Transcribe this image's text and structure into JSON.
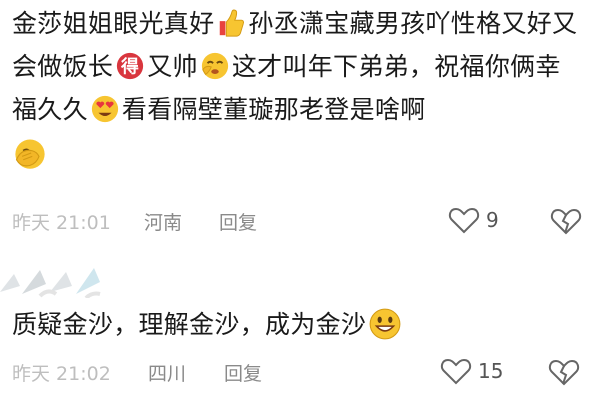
{
  "comments": [
    {
      "segments": {
        "s1": "金莎姐姐眼光真好",
        "s2": "孙丞潇宝藏男孩吖性格又好又会做饭长",
        "s3": "又帅",
        "s4": "这才叫年下弟弟，祝福你俩幸福久久",
        "s5": "看看隔壁董璇那老登是啥啊"
      },
      "emojis": [
        "thumbs-up",
        "de-sticker",
        "cheeky-face",
        "heart-eyes-face",
        "facepalm-face"
      ],
      "time": "昨天 21:01",
      "location": "河南",
      "reply_label": "回复",
      "like_count": "9"
    },
    {
      "text": "质疑金沙，理解金沙，成为金沙",
      "emojis": [
        "grinning-face"
      ],
      "time": "昨天 21:02",
      "location": "四川",
      "reply_label": "回复",
      "like_count": "15"
    }
  ],
  "sticker_text": "得",
  "colors": {
    "text": "#1a1a1a",
    "meta": "#8a8a8a",
    "emoji_yellow": "#f7c531",
    "sticker_red": "#d9363e"
  }
}
